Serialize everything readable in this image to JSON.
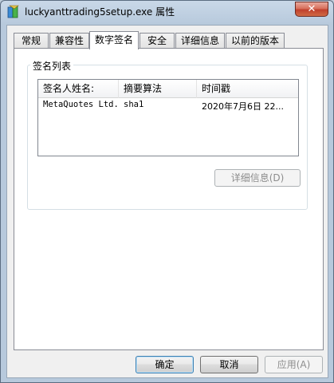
{
  "window": {
    "title": "luckyanttrading5setup.exe 属性",
    "close_label": "✕"
  },
  "tabs": [
    {
      "label": "常规"
    },
    {
      "label": "兼容性"
    },
    {
      "label": "数字签名"
    },
    {
      "label": "安全"
    },
    {
      "label": "详细信息"
    },
    {
      "label": "以前的版本"
    }
  ],
  "active_tab": "数字签名",
  "signature_group": {
    "label": "签名列表",
    "columns": [
      "签名人姓名:",
      "摘要算法",
      "时间戳"
    ],
    "rows": [
      {
        "signer": "MetaQuotes Ltd.",
        "digest": "sha1",
        "timestamp": "2020年7月6日 22..."
      }
    ],
    "details_button": "详细信息(D)"
  },
  "footer": {
    "ok": "确定",
    "cancel": "取消",
    "apply": "应用(A)"
  }
}
